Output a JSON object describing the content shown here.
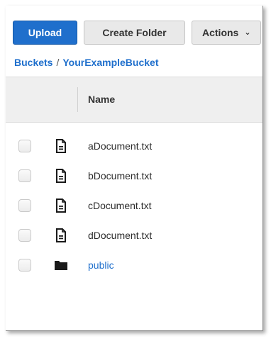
{
  "toolbar": {
    "upload_label": "Upload",
    "create_folder_label": "Create Folder",
    "actions_label": "Actions"
  },
  "breadcrumb": {
    "root": "Buckets",
    "separator": "/",
    "current": "YourExampleBucket"
  },
  "table": {
    "name_header": "Name",
    "rows": [
      {
        "name": "aDocument.txt",
        "type": "file",
        "icon": "document-icon"
      },
      {
        "name": "bDocument.txt",
        "type": "file",
        "icon": "document-icon"
      },
      {
        "name": "cDocument.txt",
        "type": "file",
        "icon": "document-icon"
      },
      {
        "name": "dDocument.txt",
        "type": "file",
        "icon": "document-icon"
      },
      {
        "name": "public",
        "type": "folder",
        "icon": "folder-icon"
      }
    ]
  },
  "colors": {
    "primary": "#1f6fcc",
    "link": "#1f6fcc",
    "header_bg": "#efefef",
    "button_bg": "#e9e9e9"
  }
}
